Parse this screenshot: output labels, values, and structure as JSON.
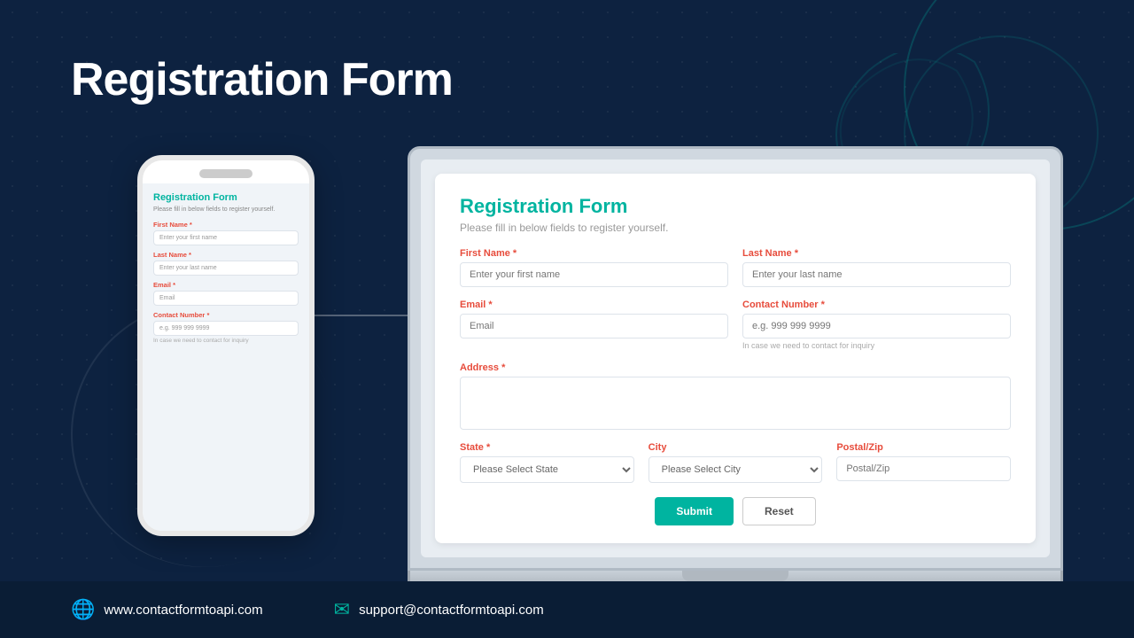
{
  "page": {
    "title": "Registration Form",
    "background_color": "#0d2240"
  },
  "footer": {
    "website": "www.contactformtoapi.com",
    "email": "support@contactformtoapi.com",
    "website_icon": "🌐",
    "email_icon": "✉"
  },
  "form": {
    "title": "Registration Form",
    "subtitle": "Please fill in below fields to register yourself.",
    "fields": {
      "first_name": {
        "label": "First Name",
        "required": true,
        "placeholder": "Enter your first name"
      },
      "last_name": {
        "label": "Last Name",
        "required": true,
        "placeholder": "Enter your last name"
      },
      "email": {
        "label": "Email",
        "required": true,
        "placeholder": "Email"
      },
      "contact_number": {
        "label": "Contact Number",
        "required": true,
        "placeholder": "e.g. 999 999 9999",
        "hint": "In case we need to contact for inquiry"
      },
      "address": {
        "label": "Address",
        "required": true,
        "placeholder": ""
      },
      "state": {
        "label": "State",
        "required": true,
        "placeholder": "Please Select State"
      },
      "city": {
        "label": "City",
        "required": false,
        "placeholder": "Please Select City"
      },
      "postal_zip": {
        "label": "Postal/Zip",
        "required": false,
        "placeholder": "Postal/Zip"
      }
    },
    "buttons": {
      "submit": "Submit",
      "reset": "Reset"
    }
  }
}
